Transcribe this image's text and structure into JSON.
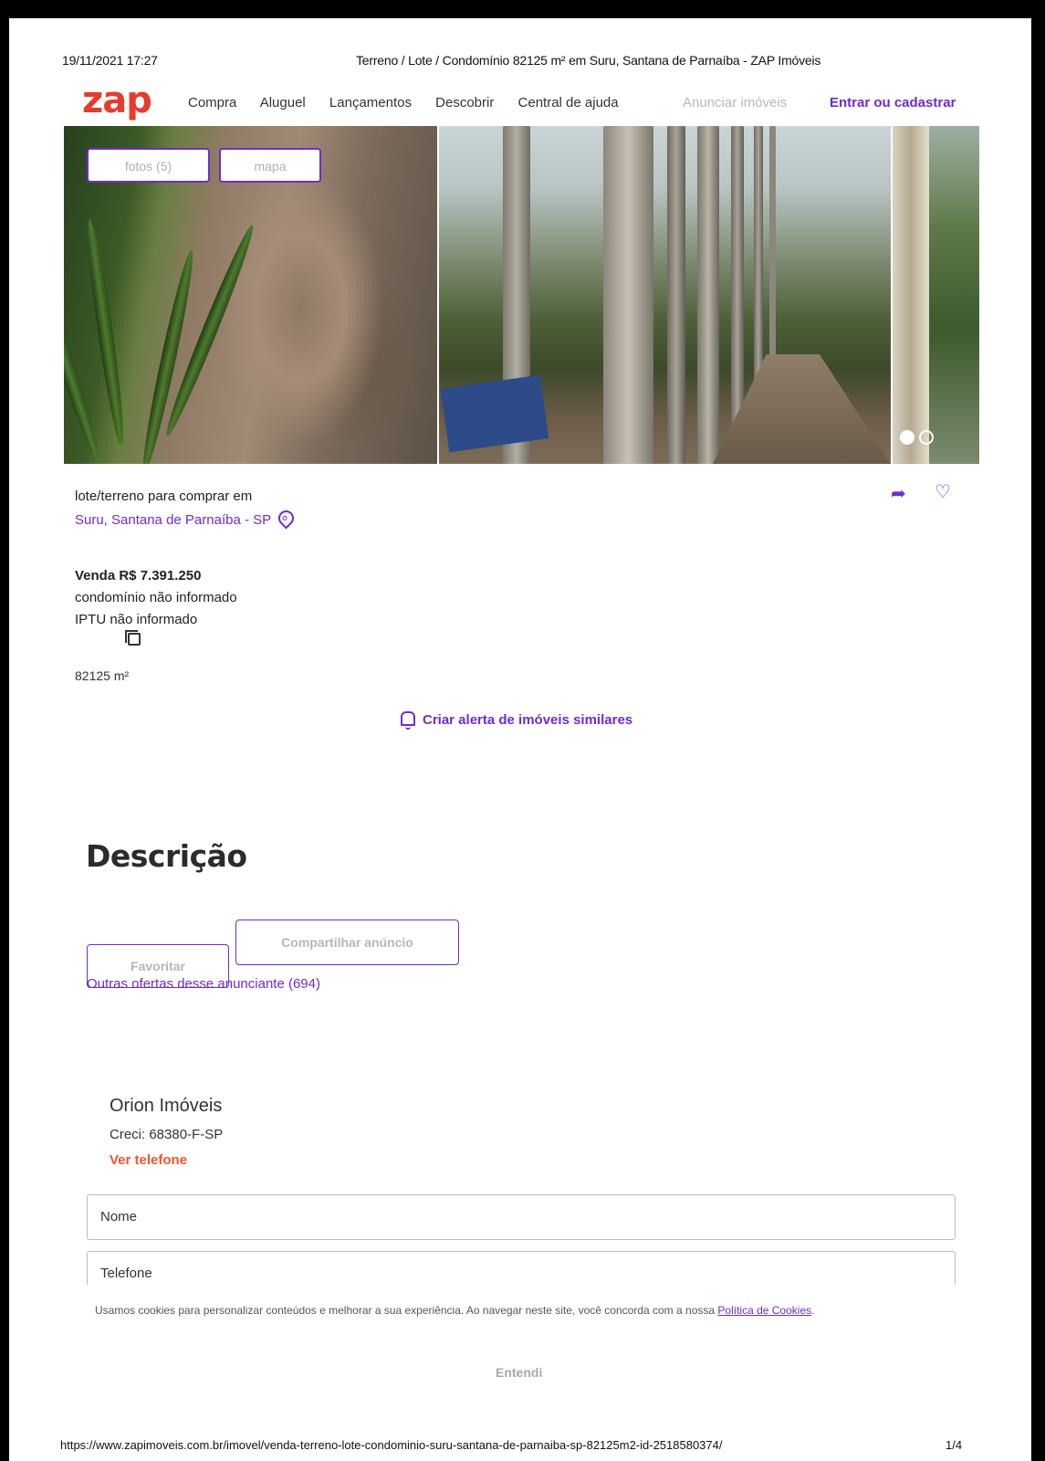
{
  "print_header": {
    "datetime": "19/11/2021 17:27",
    "title": "Terreno / Lote / Condomínio 82125 m² em Suru, Santana de Parnaíba - ZAP Imóveis"
  },
  "nav": {
    "logo": "zap",
    "links": [
      "Compra",
      "Aluguel",
      "Lançamentos",
      "Descobrir",
      "Central de ajuda"
    ],
    "anunciar": "Anunciar imóveis",
    "entrar": "Entrar ou cadastrar"
  },
  "gallery": {
    "fotos_label": "fotos (5)",
    "mapa_label": "mapa",
    "active_dot": 1,
    "dot_count": 2
  },
  "listing": {
    "type_text": "lote/terreno para comprar em",
    "location": "Suru, Santana de Parnaíba - SP",
    "venda": "Venda R$ 7.391.250",
    "condominio": "condomínio não informado",
    "iptu": "IPTU não informado",
    "area": "82125 m²",
    "alert": "Criar alerta de imóveis similares"
  },
  "description": {
    "title": "Descrição",
    "favoritar": "Favoritar",
    "compartilhar": "Compartilhar anúncio",
    "outras_ofertas": "Outras ofertas desse anunciante (694)"
  },
  "advertiser": {
    "name": "Orion Imóveis",
    "creci": "Creci: 68380-F-SP",
    "ver_telefone": "Ver telefone"
  },
  "form": {
    "nome_placeholder": "Nome",
    "telefone_placeholder": "Telefone"
  },
  "cookie": {
    "text": "Usamos cookies para personalizar conteúdos e melhorar a sua experiência. Ao navegar neste site, você concorda com a nossa ",
    "link": "Política de Cookies",
    "suffix": ".",
    "button": "Entendi"
  },
  "print_footer": {
    "url": "https://www.zapimoveis.com.br/imovel/venda-terreno-lote-condominio-suru-santana-de-parnaiba-sp-82125m2-id-2518580374/",
    "page": "1/4"
  },
  "colors": {
    "brand_purple": "#6f2bd1",
    "logo_red": "#e53d2c",
    "phone_orange": "#e9582e"
  }
}
